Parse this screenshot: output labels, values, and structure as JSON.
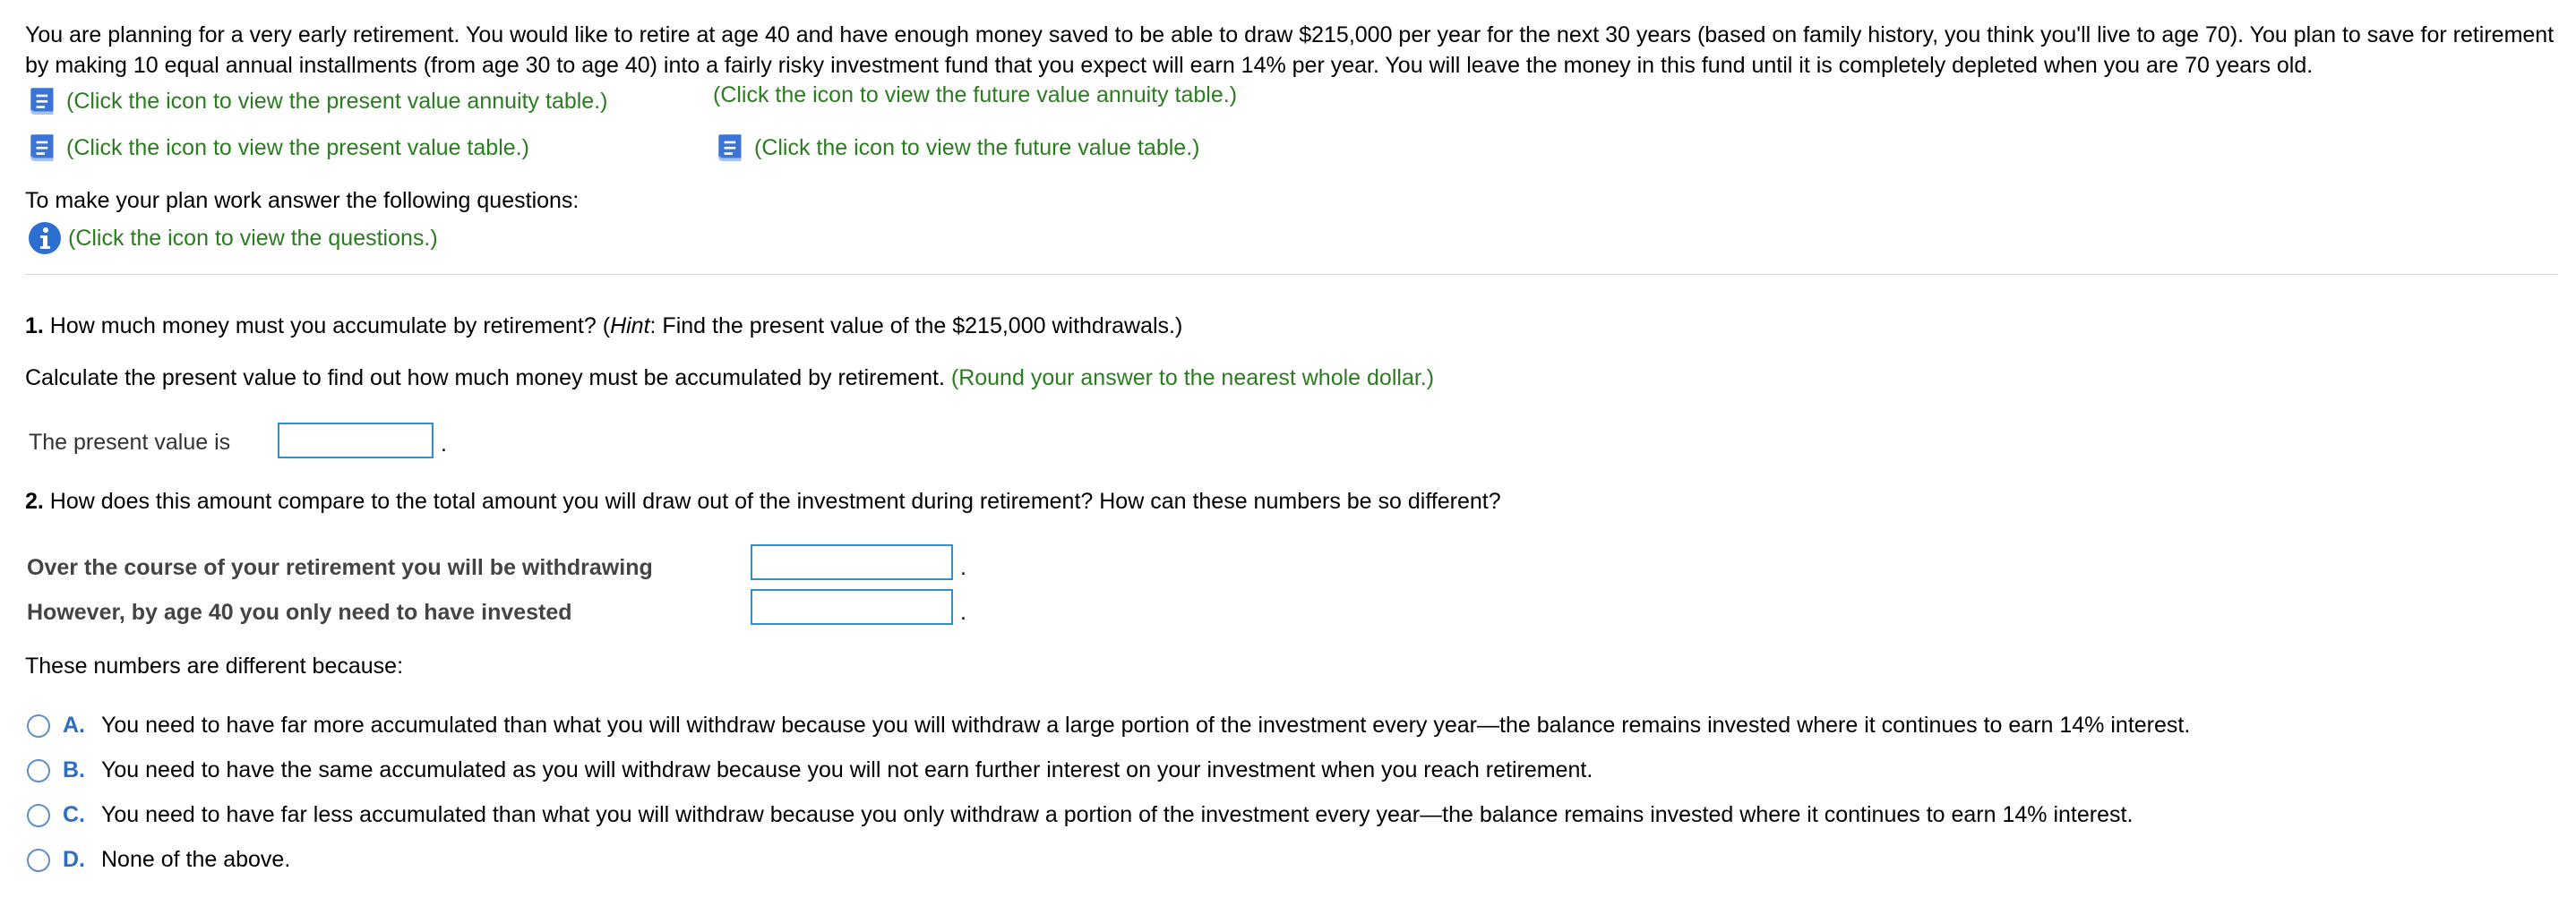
{
  "problem": {
    "intro": "You are planning for a very early retirement. You would like to retire at age 40 and have enough money saved to be able to draw $215,000 per year for the next 30 years (based on family history, you think you'll live to age 70). You plan to save for retirement by making 10 equal annual installments (from age 30 to age 40) into a fairly risky investment fund that you expect will earn 14% per year. You will leave the money in this fund until it is completely depleted when you are 70 years old."
  },
  "tables": {
    "pv_annuity": "(Click the icon to view the present value annuity table.)",
    "fv_annuity": "(Click the icon to view the future value annuity table.)",
    "pv": "(Click the icon to view the present value table.)",
    "fv": "(Click the icon to view the future value table.)"
  },
  "plan": {
    "intro": "To make your plan work answer the following questions:",
    "questions_link": "(Click the icon to view the questions.)"
  },
  "q1": {
    "number": "1.",
    "text_before_hint": " How much money must you accumulate by retirement? (",
    "hint_word": "Hint",
    "text_after_hint": ": Find the present value of the $215,000 withdrawals.)",
    "instruction": "Calculate the present value to find out how much money must be accumulated by retirement. ",
    "round_note": "(Round your answer to the nearest whole dollar.)",
    "answer_label": "The present value is",
    "answer_value": "",
    "period": "."
  },
  "q2": {
    "number": "2.",
    "text": " How does this amount compare to the total amount you will draw out of the investment during retirement? How can these numbers be so different?",
    "withdraw_label": "Over the course of your retirement you will be withdrawing",
    "withdraw_value": "",
    "invested_label": "However, by age 40 you only need to have invested",
    "invested_value": "",
    "period": ".",
    "different_label": "These numbers are different because:",
    "options": [
      {
        "letter": "A.",
        "text": "You need to have far more accumulated than what you will withdraw because you will withdraw a large portion of the investment every year—the balance remains invested where it continues to earn 14% interest."
      },
      {
        "letter": "B.",
        "text": "You need to have the same accumulated as you will withdraw because you will not earn further interest on your investment when you reach retirement."
      },
      {
        "letter": "C.",
        "text": "You need to have far less accumulated than what you will withdraw because you only withdraw a portion of the investment every year—the balance remains invested where it continues to earn 14% interest."
      },
      {
        "letter": "D.",
        "text": "None of the above."
      }
    ]
  },
  "colors": {
    "link_green": "#2a7d1f",
    "input_border": "#2f8ecf",
    "option_letter": "#2f6dbf",
    "book_icon": "#3a74d6",
    "info_icon": "#2d6fd0"
  },
  "icons": {
    "table_icon": "book-icon",
    "questions_icon": "info-icon"
  }
}
